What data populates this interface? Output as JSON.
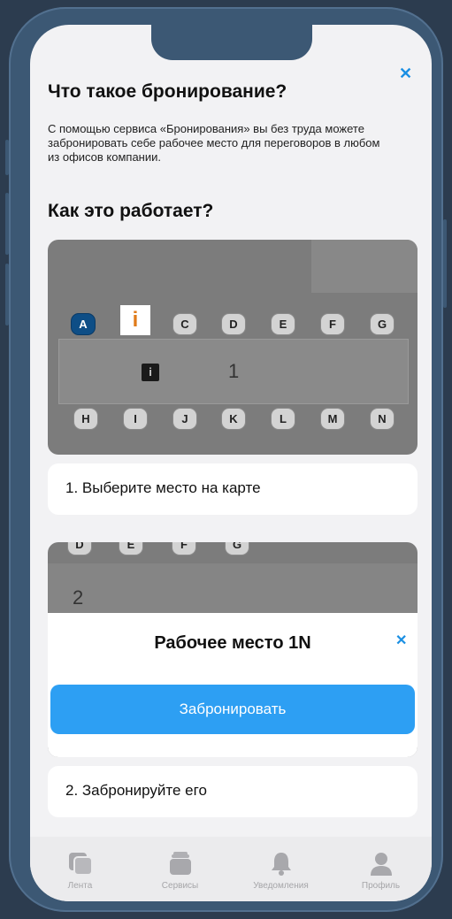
{
  "intro": {
    "title": "Что такое бронирование?",
    "description": "С помощью сервиса «Бронирования» вы без труда можете забронировать себе рабочее место для переговоров в любом из офисов компании.",
    "how_title": "Как это работает?"
  },
  "map1": {
    "top_row": [
      "A",
      "C",
      "D",
      "E",
      "F",
      "G"
    ],
    "info_glyph": "i",
    "info_small": "i",
    "desk_number": "1",
    "bottom_row": [
      "H",
      "I",
      "J",
      "K",
      "L",
      "M",
      "N"
    ]
  },
  "steps": {
    "step1": "1. Выберите место на карте",
    "step2": "2. Забронируйте его"
  },
  "map2": {
    "top_row": [
      "D",
      "E",
      "F",
      "G"
    ],
    "desk_number": "2"
  },
  "modal": {
    "title": "Рабочее место 1N",
    "button": "Забронировать"
  },
  "tabbar": {
    "items": [
      {
        "label": "Лента",
        "icon": "feed-icon"
      },
      {
        "label": "Сервисы",
        "icon": "services-icon"
      },
      {
        "label": "Уведомления",
        "icon": "bell-icon"
      },
      {
        "label": "Профиль",
        "icon": "profile-icon"
      }
    ]
  },
  "colors": {
    "accent": "#2d9ff3",
    "info": "#e07b1a",
    "frame": "#3c5874"
  }
}
